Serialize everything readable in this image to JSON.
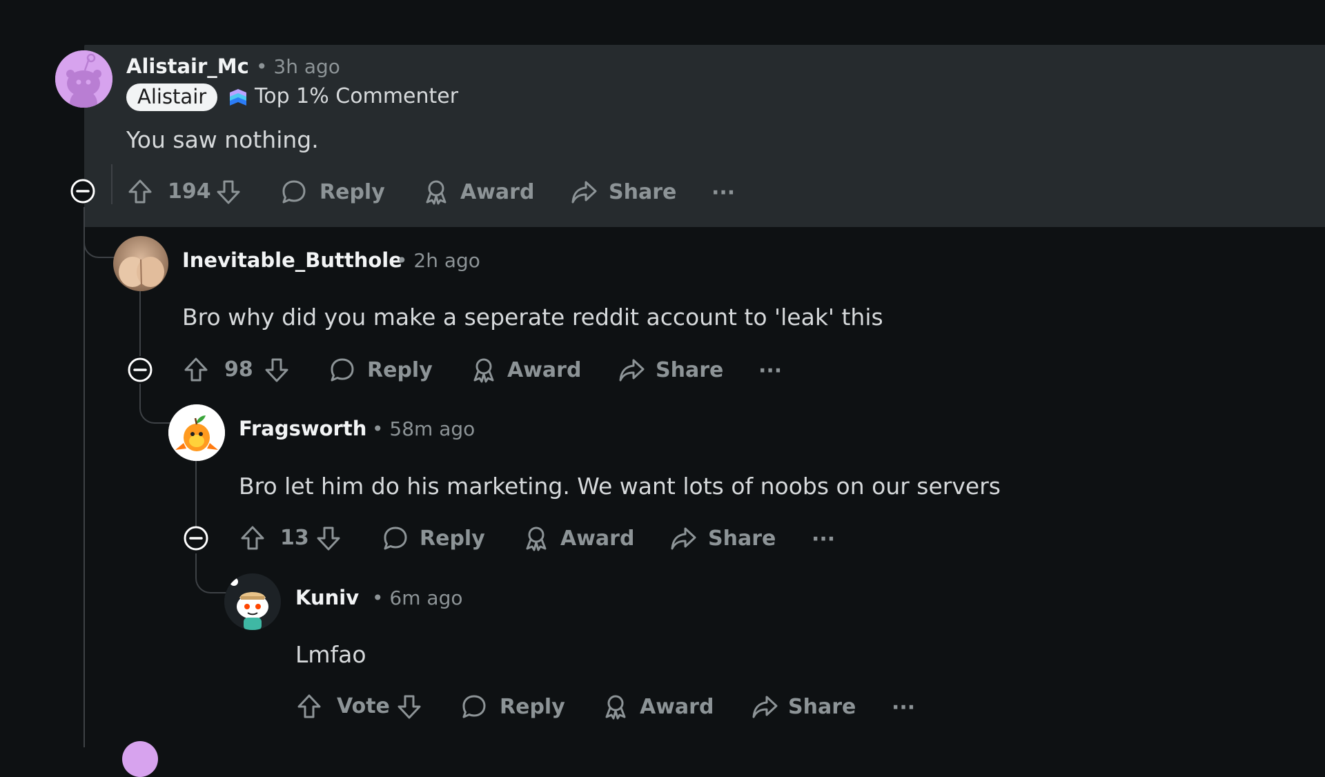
{
  "colors": {
    "background": "#0e1113",
    "highlight": "#262b2e",
    "meta_text": "#8d9497",
    "username": "#f2f4f5",
    "thread_line": "#3e4246"
  },
  "actions": {
    "reply_label": "Reply",
    "award_label": "Award",
    "share_label": "Share",
    "more_label": "···"
  },
  "comments": [
    {
      "username": "Alistair_Mc",
      "time": "• 3h ago",
      "flair": "Alistair",
      "badge": "Top 1% Commenter",
      "body": "You saw nothing.",
      "votes": "194",
      "avatar_icon": "snoo-default-avatar-icon"
    },
    {
      "username": "Inevitable_Butthole",
      "time": "• 2h ago",
      "body": "Bro why did you make a seperate reddit account to 'leak' this",
      "votes": "98",
      "avatar_icon": "photo-avatar"
    },
    {
      "username": "Fragsworth",
      "time": "• 58m ago",
      "body": "Bro let him do his marketing. We want lots of noobs on our servers",
      "votes": "13",
      "avatar_icon": "orange-fish-avatar"
    },
    {
      "username": "Kuniv",
      "time": "• 6m ago",
      "body": "Lmfao",
      "votes": "Vote",
      "avatar_icon": "snoo-chef-avatar"
    }
  ]
}
